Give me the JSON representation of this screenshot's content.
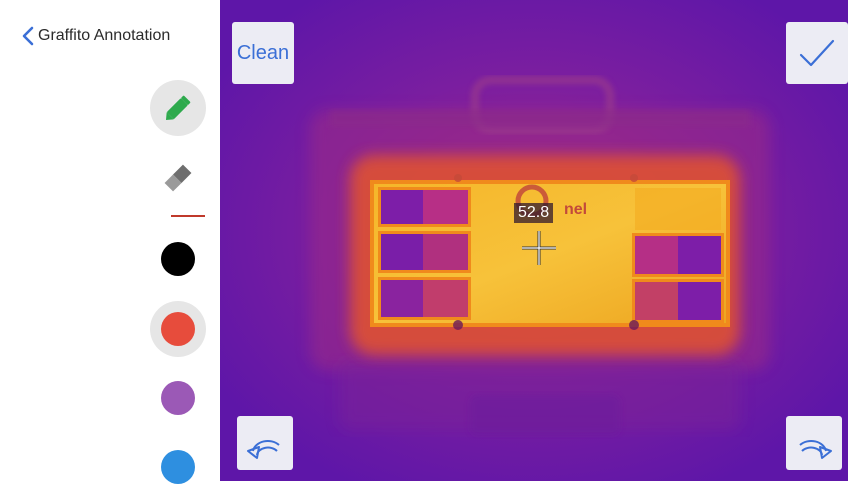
{
  "header": {
    "back_label": "Graffito Annotation"
  },
  "tools": {
    "pencil_icon": "pencil-icon",
    "eraser_icon": "eraser-icon",
    "selected": "pencil"
  },
  "stroke": {
    "color": "#c0392b"
  },
  "palette": {
    "colors": [
      "#000000",
      "#e74c3c",
      "#9b59b6",
      "#2e8fe0"
    ],
    "selected_color": "#e74c3c"
  },
  "canvas": {
    "clean_label": "Clean",
    "confirm_icon": "checkmark-icon",
    "undo_icon": "undo-icon",
    "redo_icon": "redo-icon",
    "temperature": "52.8",
    "crosshair_icon": "crosshair-icon",
    "logo_text": "nel"
  },
  "colors": {
    "accent": "#3b6fd6",
    "pencil": "#2eaa4d",
    "thermal_background": "#6a1aa8"
  }
}
